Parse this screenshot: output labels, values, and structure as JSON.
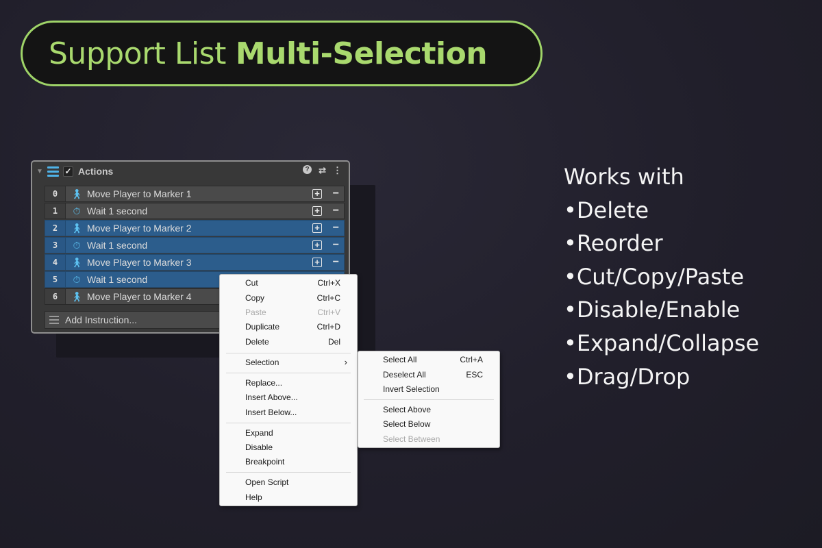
{
  "title": {
    "normal": "Support List",
    "bold": "Multi-Selection"
  },
  "panel": {
    "header_label": "Actions",
    "rows": [
      {
        "index": "0",
        "icon": "walking-person-icon",
        "text": "Move Player to Marker 1",
        "selected": false
      },
      {
        "index": "1",
        "icon": "stopwatch-icon",
        "text": "Wait 1 second",
        "selected": false
      },
      {
        "index": "2",
        "icon": "walking-person-icon",
        "text": "Move Player to Marker 2",
        "selected": true
      },
      {
        "index": "3",
        "icon": "stopwatch-icon",
        "text": "Wait 1 second",
        "selected": true
      },
      {
        "index": "4",
        "icon": "walking-person-icon",
        "text": "Move Player to Marker 3",
        "selected": true
      },
      {
        "index": "5",
        "icon": "stopwatch-icon",
        "text": "Wait 1 second",
        "selected": true
      },
      {
        "index": "6",
        "icon": "walking-person-icon",
        "text": "Move Player to Marker 4",
        "selected": false
      }
    ],
    "add_instruction": "Add Instruction..."
  },
  "context_menu": {
    "cut": {
      "label": "Cut",
      "shortcut": "Ctrl+X"
    },
    "copy": {
      "label": "Copy",
      "shortcut": "Ctrl+C"
    },
    "paste": {
      "label": "Paste",
      "shortcut": "Ctrl+V"
    },
    "duplicate": {
      "label": "Duplicate",
      "shortcut": "Ctrl+D"
    },
    "delete": {
      "label": "Delete",
      "shortcut": "Del"
    },
    "selection": {
      "label": "Selection"
    },
    "replace": {
      "label": "Replace..."
    },
    "insert_above": {
      "label": "Insert Above..."
    },
    "insert_below": {
      "label": "Insert Below..."
    },
    "expand": {
      "label": "Expand"
    },
    "disable": {
      "label": "Disable"
    },
    "breakpoint": {
      "label": "Breakpoint"
    },
    "open_script": {
      "label": "Open Script"
    },
    "help": {
      "label": "Help"
    }
  },
  "submenu": {
    "select_all": {
      "label": "Select All",
      "shortcut": "Ctrl+A"
    },
    "deselect_all": {
      "label": "Deselect All",
      "shortcut": "ESC"
    },
    "invert_selection": {
      "label": "Invert Selection"
    },
    "select_above": {
      "label": "Select Above"
    },
    "select_below": {
      "label": "Select Below"
    },
    "select_between": {
      "label": "Select Between"
    }
  },
  "features": {
    "heading": "Works with",
    "items": [
      "•Delete",
      "•Reorder",
      "•Cut/Copy/Paste",
      "•Disable/Enable",
      "•Expand/Collapse",
      "•Drag/Drop"
    ]
  },
  "colors": {
    "accent_green": "#9fd468",
    "selection_blue": "#2c5d8c",
    "icon_blue": "#5dc1f0"
  }
}
